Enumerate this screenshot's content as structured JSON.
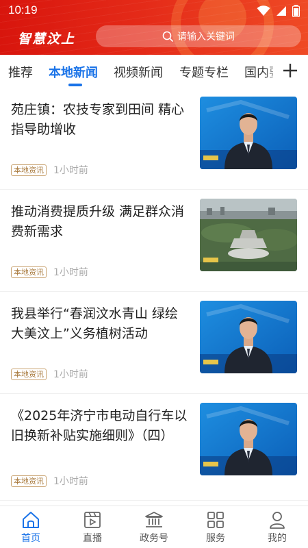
{
  "status_bar": {
    "time": "10:19"
  },
  "header": {
    "brand": "智慧汶上",
    "search_placeholder": "请输入关键词"
  },
  "tabs": [
    {
      "label": "推荐",
      "active": false
    },
    {
      "label": "本地新闻",
      "active": true
    },
    {
      "label": "视频新闻",
      "active": false
    },
    {
      "label": "专题专栏",
      "active": false
    },
    {
      "label": "国内要",
      "active": false
    }
  ],
  "news": [
    {
      "title": "苑庄镇：农技专家到田间  精心指导助增收",
      "tag": "本地资讯",
      "time": "1小时前",
      "thumb": "anchor-icon"
    },
    {
      "title": "推动消费提质升级  满足群众消费新需求",
      "tag": "本地资讯",
      "time": "1小时前",
      "thumb": "aerial-view-icon"
    },
    {
      "title": "我县举行“春润汶水青山  绿绘大美汶上”义务植树活动",
      "tag": "本地资讯",
      "time": "1小时前",
      "thumb": "anchor-icon"
    },
    {
      "title": "《2025年济宁市电动自行车以旧换新补贴实施细则》（四）",
      "tag": "本地资讯",
      "time": "1小时前",
      "thumb": "anchor-icon"
    }
  ],
  "bottom_nav": [
    {
      "label": "首页",
      "icon": "home-icon",
      "active": true
    },
    {
      "label": "直播",
      "icon": "live-icon",
      "active": false
    },
    {
      "label": "政务号",
      "icon": "government-icon",
      "active": false
    },
    {
      "label": "服务",
      "icon": "services-icon",
      "active": false
    },
    {
      "label": "我的",
      "icon": "profile-icon",
      "active": false
    }
  ],
  "colors": {
    "header_red": "#d8150d",
    "accent_blue": "#1a73e8",
    "tag_brown": "#a8793c"
  }
}
